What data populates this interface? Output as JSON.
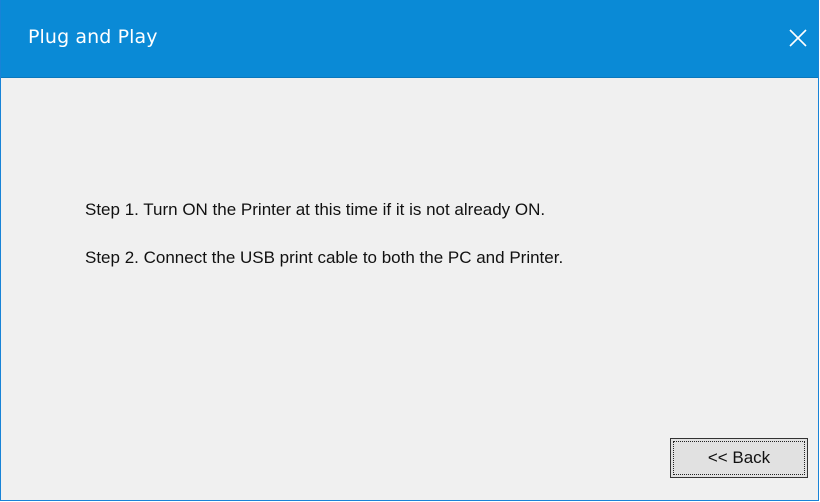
{
  "window": {
    "title": "Plug and Play"
  },
  "icons": {
    "close": "close-icon"
  },
  "steps": [
    "Step 1.  Turn ON the Printer at this time if it is not already ON.",
    "Step 2.  Connect the USB print cable to both the PC and Printer."
  ],
  "buttons": {
    "back_label": "<< Back"
  },
  "colors": {
    "titlebar": "#0a8ad6",
    "window_background": "#f0f0f0",
    "button_background": "#e1e1e1"
  }
}
